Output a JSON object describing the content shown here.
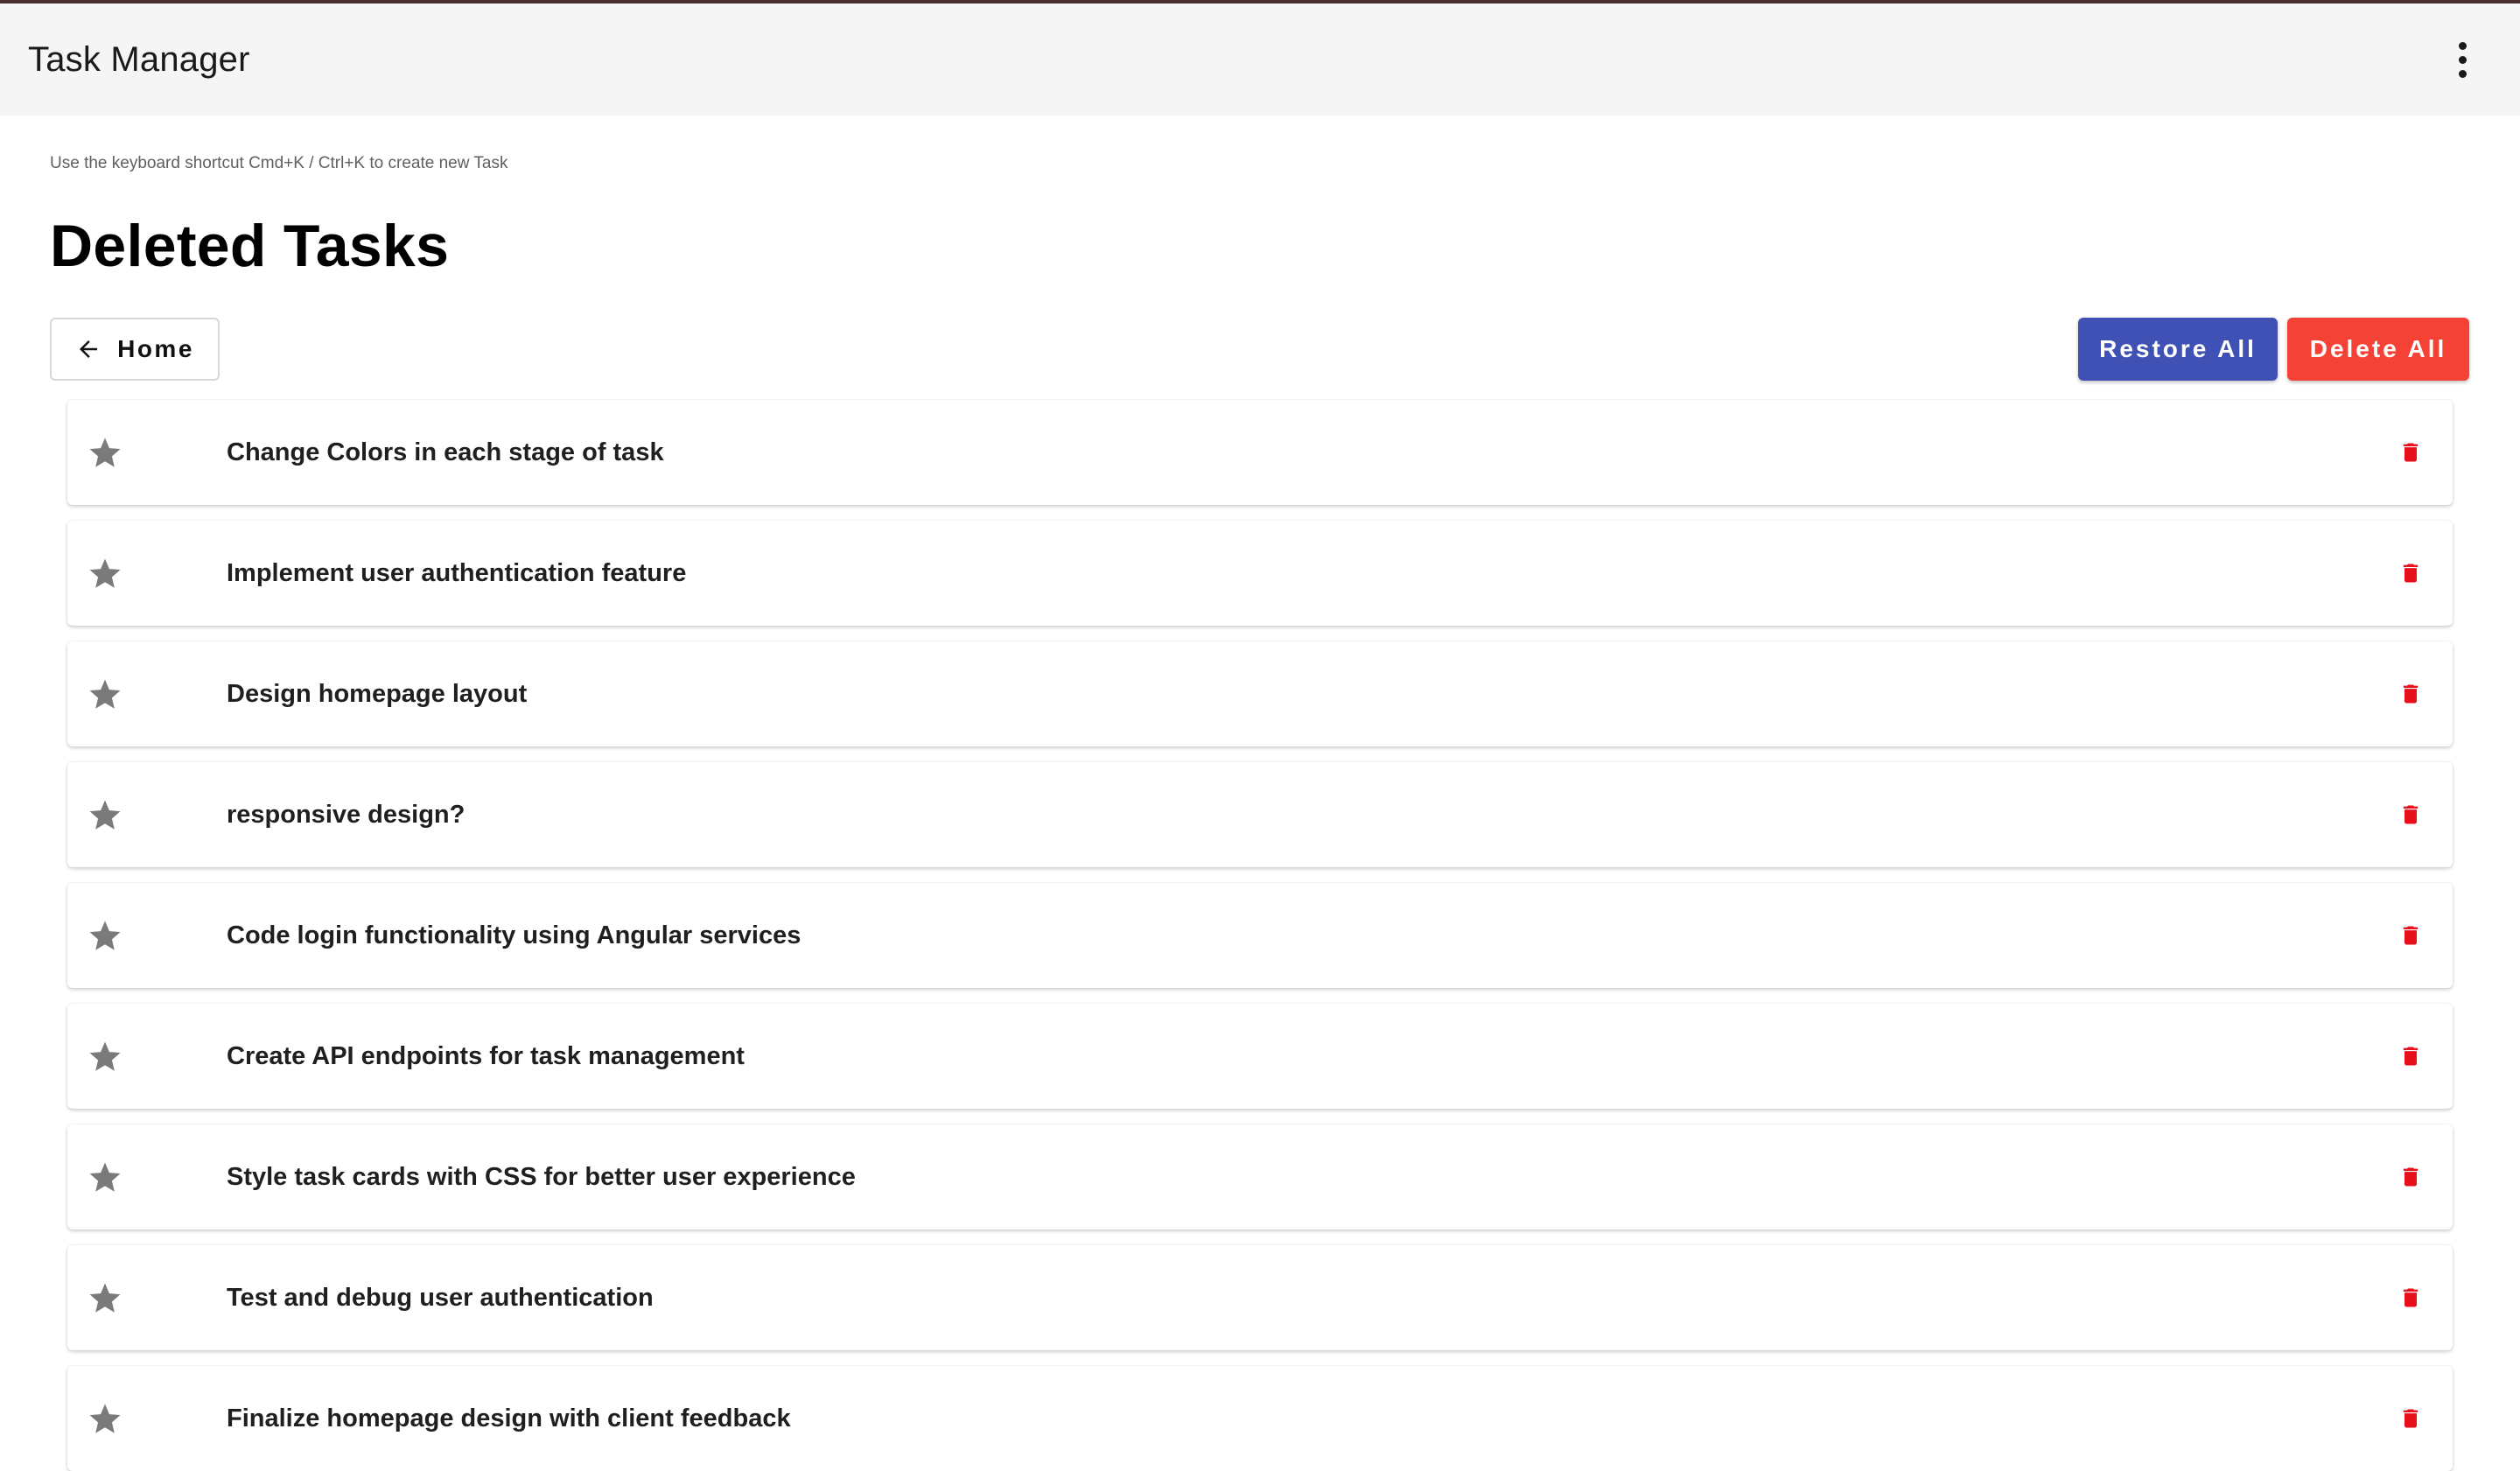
{
  "app": {
    "title": "Task Manager",
    "menu_icon": "more-vert-icon"
  },
  "page": {
    "hint": "Use the keyboard shortcut Cmd+K / Ctrl+K to create new Task",
    "title": "Deleted Tasks"
  },
  "actions": {
    "home_label": "Home",
    "home_icon": "arrow-back-icon",
    "restore_all_label": "Restore All",
    "delete_all_label": "Delete All",
    "restore_color": "#3f51b5",
    "delete_color": "#f44336"
  },
  "tasks": [
    {
      "title": "Change Colors in each stage of task",
      "starred": false
    },
    {
      "title": "Implement user authentication feature",
      "starred": false
    },
    {
      "title": "Design homepage layout",
      "starred": false
    },
    {
      "title": "responsive design?",
      "starred": false
    },
    {
      "title": "Code login functionality using Angular services",
      "starred": false
    },
    {
      "title": "Create API endpoints for task management",
      "starred": false
    },
    {
      "title": "Style task cards with CSS for better user experience",
      "starred": false
    },
    {
      "title": "Test and debug user authentication",
      "starred": false
    },
    {
      "title": "Finalize homepage design with client feedback",
      "starred": false
    }
  ],
  "colors": {
    "star": "#7a7a7a",
    "trash": "#e8111b"
  }
}
